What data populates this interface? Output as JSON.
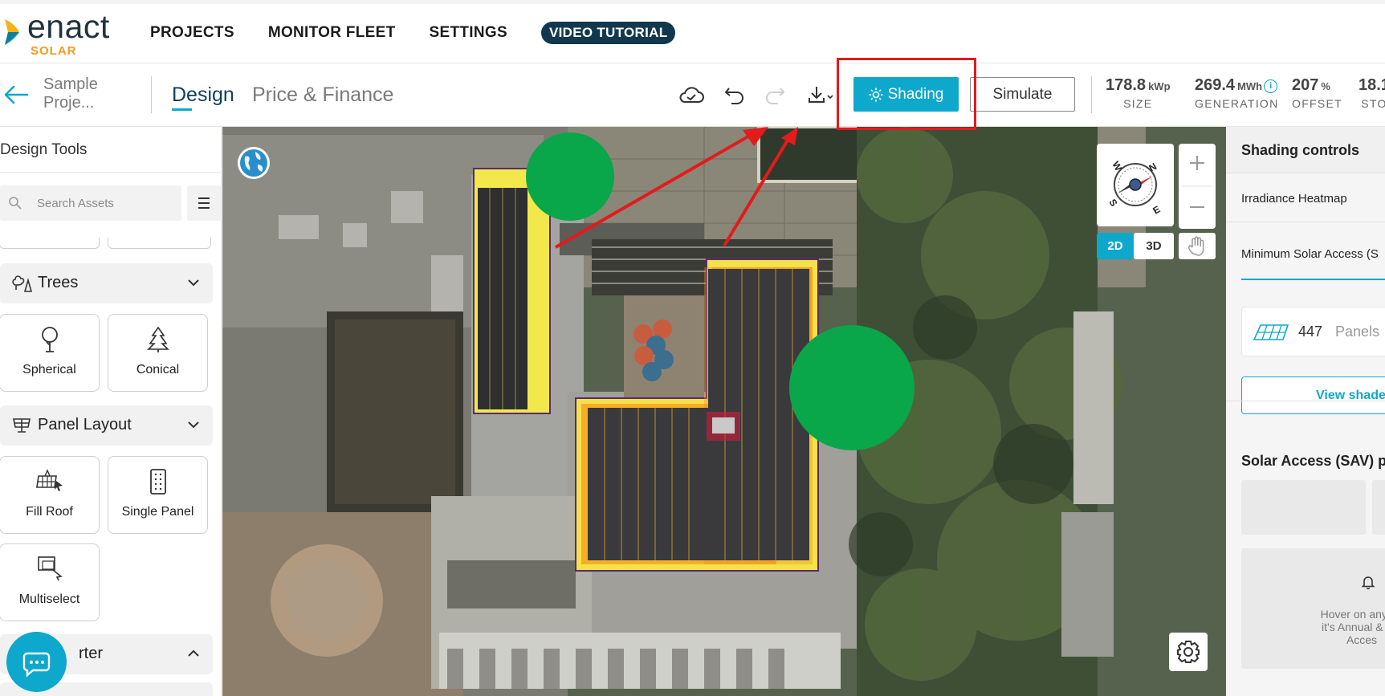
{
  "brand": {
    "name": "enact",
    "sub": "SOLAR"
  },
  "topnav": {
    "links": [
      "PROJECTS",
      "MONITOR FLEET",
      "SETTINGS"
    ],
    "video": "VIDEO TUTORIAL"
  },
  "project": {
    "name_line1": "Sample",
    "name_line2": "Proje..."
  },
  "tabs": {
    "design": "Design",
    "price": "Price & Finance"
  },
  "toolbar": {
    "shading": "Shading",
    "simulate": "Simulate"
  },
  "stats": {
    "size": {
      "value": "178.8",
      "unit": "kWp",
      "label": "SIZE"
    },
    "generation": {
      "value": "269.4",
      "unit": "MWh",
      "label": "GENERATION"
    },
    "offset": {
      "value": "207",
      "unit": "%",
      "label": "OFFSET"
    },
    "storage": {
      "value": "18.1",
      "label": "STO"
    }
  },
  "left_panel": {
    "title": "Design Tools",
    "search_placeholder": "Search Assets",
    "sections": {
      "trees": "Trees",
      "panel_layout": "Panel Layout",
      "inverter": "rter"
    },
    "tools": {
      "spherical": "Spherical",
      "conical": "Conical",
      "fill_roof": "Fill Roof",
      "single_panel": "Single Panel",
      "multiselect": "Multiselect"
    }
  },
  "map_controls": {
    "btn_2d": "2D",
    "btn_3d": "3D",
    "compass": {
      "n": "N",
      "e": "E",
      "s": "S",
      "w": "W"
    }
  },
  "right_panel": {
    "title": "Shading controls",
    "irradiance": "Irradiance Heatmap",
    "min_solar": "Minimum Solar Access (S",
    "panels_count": "447",
    "panels_label": "Panels",
    "view_shade": "View shade",
    "sav_title": "Solar Access (SAV) pe",
    "hover_line1": "Hover on any pa",
    "hover_line2": "it's Annual & Mo",
    "hover_line3": "Acces"
  },
  "colors": {
    "accent": "#0ea8cc",
    "brand_dark": "#12384f",
    "brand_orange": "#f39a1e",
    "highlight_red": "#e31b1b",
    "marker_green": "#0aa64a"
  }
}
